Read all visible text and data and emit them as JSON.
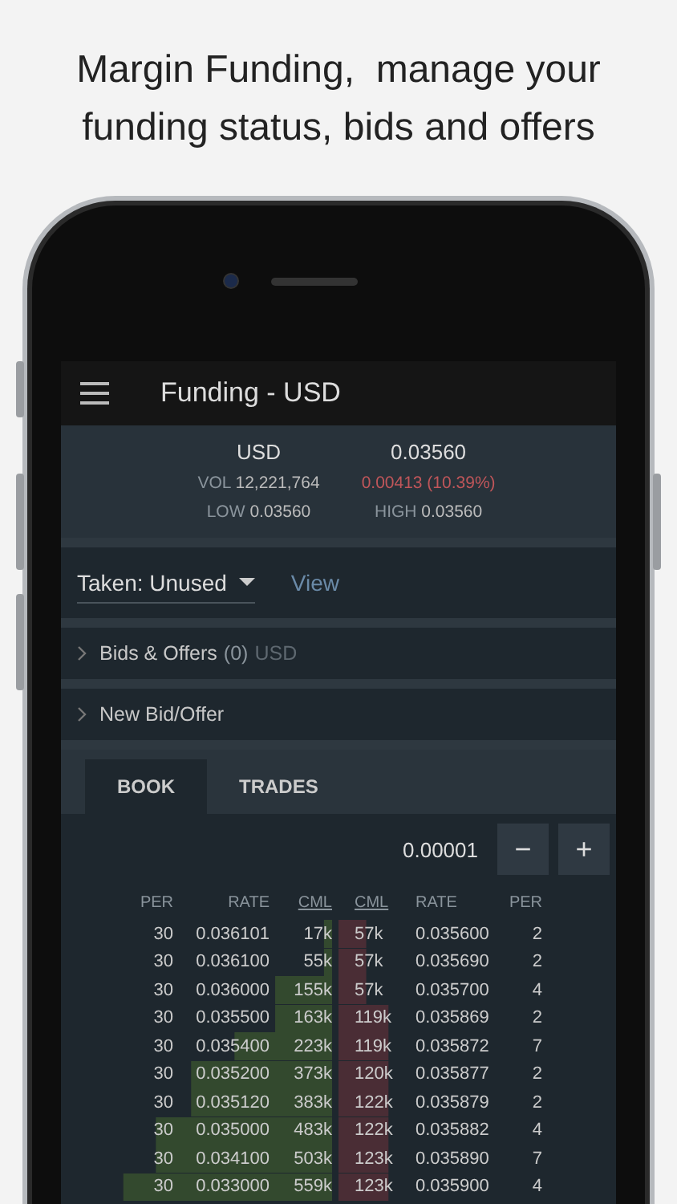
{
  "headline": "Margin Funding,  manage your funding status, bids and offers",
  "app_bar": {
    "title": "Funding - USD"
  },
  "ticker": {
    "currency": "USD",
    "last": "0.03560",
    "vol_label": "VOL",
    "vol": "12,221,764",
    "change": "0.00413 (10.39%)",
    "low_label": "LOW",
    "low": "0.03560",
    "high_label": "HIGH",
    "high": "0.03560"
  },
  "filter": {
    "value": "Taken: Unused",
    "link": "View"
  },
  "sections": [
    {
      "label": "Bids & Offers",
      "count": "(0)",
      "unit": "USD",
      "expanded": false
    },
    {
      "label": "New Bid/Offer",
      "expanded": false
    }
  ],
  "tabs": [
    {
      "label": "BOOK",
      "selected": true
    },
    {
      "label": "TRADES",
      "selected": false
    }
  ],
  "precision": {
    "value": "0.00001",
    "minus": "−",
    "plus": "+"
  },
  "book": {
    "columns": [
      "PER",
      "RATE",
      "CML",
      "CML",
      "RATE",
      "PER"
    ],
    "rows": [
      {
        "bid": {
          "per": "30",
          "rate": "0.036101",
          "cml": "17k",
          "level": 0.03
        },
        "ask": {
          "cml": "57k",
          "rate": "0.035600",
          "per": "2",
          "level": 0.1
        }
      },
      {
        "bid": {
          "per": "30",
          "rate": "0.036100",
          "cml": "55k",
          "level": 0.03
        },
        "ask": {
          "cml": "57k",
          "rate": "0.035690",
          "per": "2",
          "level": 0.1
        }
      },
      {
        "bid": {
          "per": "30",
          "rate": "0.036000",
          "cml": "155k",
          "level": 0.21
        },
        "ask": {
          "cml": "57k",
          "rate": "0.035700",
          "per": "4",
          "level": 0.1
        }
      },
      {
        "bid": {
          "per": "30",
          "rate": "0.035500",
          "cml": "163k",
          "level": 0.21
        },
        "ask": {
          "cml": "119k",
          "rate": "0.035869",
          "per": "2",
          "level": 0.18
        }
      },
      {
        "bid": {
          "per": "30",
          "rate": "0.035400",
          "cml": "223k",
          "level": 0.36
        },
        "ask": {
          "cml": "119k",
          "rate": "0.035872",
          "per": "7",
          "level": 0.18
        }
      },
      {
        "bid": {
          "per": "30",
          "rate": "0.035200",
          "cml": "373k",
          "level": 0.52
        },
        "ask": {
          "cml": "120k",
          "rate": "0.035877",
          "per": "2",
          "level": 0.18
        }
      },
      {
        "bid": {
          "per": "30",
          "rate": "0.035120",
          "cml": "383k",
          "level": 0.52
        },
        "ask": {
          "cml": "122k",
          "rate": "0.035879",
          "per": "2",
          "level": 0.18
        }
      },
      {
        "bid": {
          "per": "30",
          "rate": "0.035000",
          "cml": "483k",
          "level": 0.65
        },
        "ask": {
          "cml": "122k",
          "rate": "0.035882",
          "per": "4",
          "level": 0.18
        }
      },
      {
        "bid": {
          "per": "30",
          "rate": "0.034100",
          "cml": "503k",
          "level": 0.65
        },
        "ask": {
          "cml": "123k",
          "rate": "0.035890",
          "per": "7",
          "level": 0.18
        }
      },
      {
        "bid": {
          "per": "30",
          "rate": "0.033000",
          "cml": "559k",
          "level": 0.77
        },
        "ask": {
          "cml": "123k",
          "rate": "0.035900",
          "per": "4",
          "level": 0.18
        }
      }
    ]
  }
}
